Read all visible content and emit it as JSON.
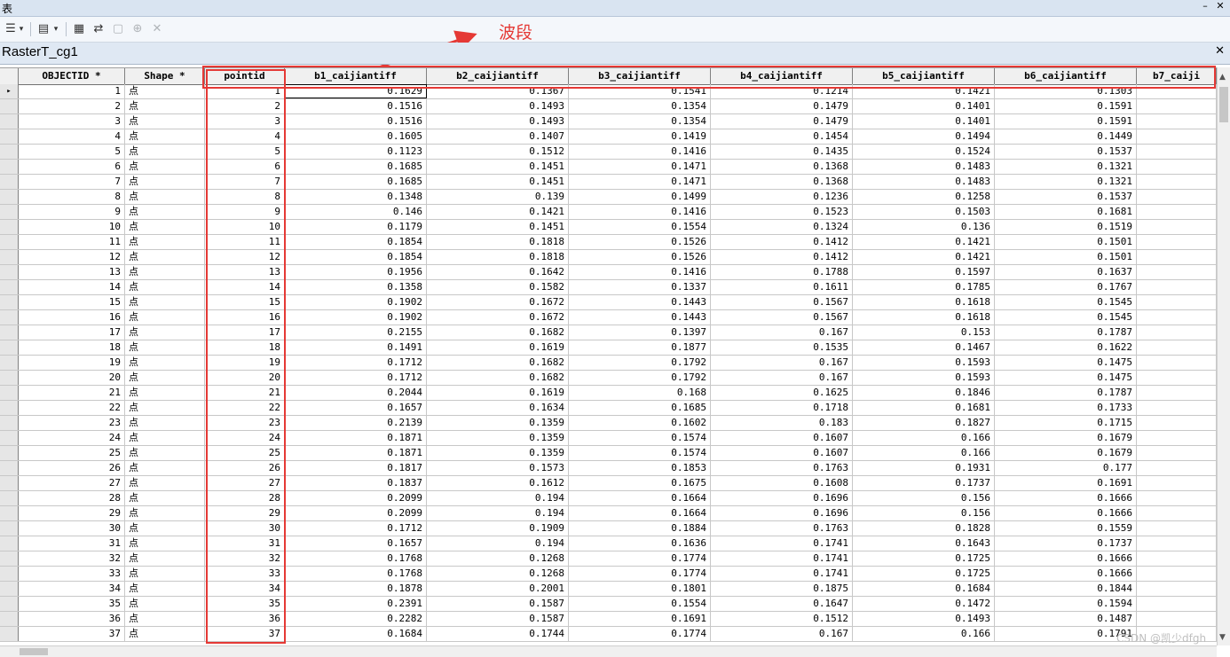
{
  "window": {
    "title": "表"
  },
  "annotation": {
    "label": "波段"
  },
  "table": {
    "tab_name": "RasterT_cg1",
    "columns": [
      "OBJECTID *",
      "Shape *",
      "pointid",
      "b1_caijiantiff",
      "b2_caijiantiff",
      "b3_caijiantiff",
      "b4_caijiantiff",
      "b5_caijiantiff",
      "b6_caijiantiff",
      "b7_caiji"
    ],
    "rows": [
      [
        "1",
        "点",
        "1",
        "0.1629",
        "0.1367",
        "0.1541",
        "0.1214",
        "0.1421",
        "0.1303"
      ],
      [
        "2",
        "点",
        "2",
        "0.1516",
        "0.1493",
        "0.1354",
        "0.1479",
        "0.1401",
        "0.1591"
      ],
      [
        "3",
        "点",
        "3",
        "0.1516",
        "0.1493",
        "0.1354",
        "0.1479",
        "0.1401",
        "0.1591"
      ],
      [
        "4",
        "点",
        "4",
        "0.1605",
        "0.1407",
        "0.1419",
        "0.1454",
        "0.1494",
        "0.1449"
      ],
      [
        "5",
        "点",
        "5",
        "0.1123",
        "0.1512",
        "0.1416",
        "0.1435",
        "0.1524",
        "0.1537"
      ],
      [
        "6",
        "点",
        "6",
        "0.1685",
        "0.1451",
        "0.1471",
        "0.1368",
        "0.1483",
        "0.1321"
      ],
      [
        "7",
        "点",
        "7",
        "0.1685",
        "0.1451",
        "0.1471",
        "0.1368",
        "0.1483",
        "0.1321"
      ],
      [
        "8",
        "点",
        "8",
        "0.1348",
        "0.139",
        "0.1499",
        "0.1236",
        "0.1258",
        "0.1537"
      ],
      [
        "9",
        "点",
        "9",
        "0.146",
        "0.1421",
        "0.1416",
        "0.1523",
        "0.1503",
        "0.1681"
      ],
      [
        "10",
        "点",
        "10",
        "0.1179",
        "0.1451",
        "0.1554",
        "0.1324",
        "0.136",
        "0.1519"
      ],
      [
        "11",
        "点",
        "11",
        "0.1854",
        "0.1818",
        "0.1526",
        "0.1412",
        "0.1421",
        "0.1501"
      ],
      [
        "12",
        "点",
        "12",
        "0.1854",
        "0.1818",
        "0.1526",
        "0.1412",
        "0.1421",
        "0.1501"
      ],
      [
        "13",
        "点",
        "13",
        "0.1956",
        "0.1642",
        "0.1416",
        "0.1788",
        "0.1597",
        "0.1637"
      ],
      [
        "14",
        "点",
        "14",
        "0.1358",
        "0.1582",
        "0.1337",
        "0.1611",
        "0.1785",
        "0.1767"
      ],
      [
        "15",
        "点",
        "15",
        "0.1902",
        "0.1672",
        "0.1443",
        "0.1567",
        "0.1618",
        "0.1545"
      ],
      [
        "16",
        "点",
        "16",
        "0.1902",
        "0.1672",
        "0.1443",
        "0.1567",
        "0.1618",
        "0.1545"
      ],
      [
        "17",
        "点",
        "17",
        "0.2155",
        "0.1682",
        "0.1397",
        "0.167",
        "0.153",
        "0.1787"
      ],
      [
        "18",
        "点",
        "18",
        "0.1491",
        "0.1619",
        "0.1877",
        "0.1535",
        "0.1467",
        "0.1622"
      ],
      [
        "19",
        "点",
        "19",
        "0.1712",
        "0.1682",
        "0.1792",
        "0.167",
        "0.1593",
        "0.1475"
      ],
      [
        "20",
        "点",
        "20",
        "0.1712",
        "0.1682",
        "0.1792",
        "0.167",
        "0.1593",
        "0.1475"
      ],
      [
        "21",
        "点",
        "21",
        "0.2044",
        "0.1619",
        "0.168",
        "0.1625",
        "0.1846",
        "0.1787"
      ],
      [
        "22",
        "点",
        "22",
        "0.1657",
        "0.1634",
        "0.1685",
        "0.1718",
        "0.1681",
        "0.1733"
      ],
      [
        "23",
        "点",
        "23",
        "0.2139",
        "0.1359",
        "0.1602",
        "0.183",
        "0.1827",
        "0.1715"
      ],
      [
        "24",
        "点",
        "24",
        "0.1871",
        "0.1359",
        "0.1574",
        "0.1607",
        "0.166",
        "0.1679"
      ],
      [
        "25",
        "点",
        "25",
        "0.1871",
        "0.1359",
        "0.1574",
        "0.1607",
        "0.166",
        "0.1679"
      ],
      [
        "26",
        "点",
        "26",
        "0.1817",
        "0.1573",
        "0.1853",
        "0.1763",
        "0.1931",
        "0.177"
      ],
      [
        "27",
        "点",
        "27",
        "0.1837",
        "0.1612",
        "0.1675",
        "0.1608",
        "0.1737",
        "0.1691"
      ],
      [
        "28",
        "点",
        "28",
        "0.2099",
        "0.194",
        "0.1664",
        "0.1696",
        "0.156",
        "0.1666"
      ],
      [
        "29",
        "点",
        "29",
        "0.2099",
        "0.194",
        "0.1664",
        "0.1696",
        "0.156",
        "0.1666"
      ],
      [
        "30",
        "点",
        "30",
        "0.1712",
        "0.1909",
        "0.1884",
        "0.1763",
        "0.1828",
        "0.1559"
      ],
      [
        "31",
        "点",
        "31",
        "0.1657",
        "0.194",
        "0.1636",
        "0.1741",
        "0.1643",
        "0.1737"
      ],
      [
        "32",
        "点",
        "32",
        "0.1768",
        "0.1268",
        "0.1774",
        "0.1741",
        "0.1725",
        "0.1666"
      ],
      [
        "33",
        "点",
        "33",
        "0.1768",
        "0.1268",
        "0.1774",
        "0.1741",
        "0.1725",
        "0.1666"
      ],
      [
        "34",
        "点",
        "34",
        "0.1878",
        "0.2001",
        "0.1801",
        "0.1875",
        "0.1684",
        "0.1844"
      ],
      [
        "35",
        "点",
        "35",
        "0.2391",
        "0.1587",
        "0.1554",
        "0.1647",
        "0.1472",
        "0.1594"
      ],
      [
        "36",
        "点",
        "36",
        "0.2282",
        "0.1587",
        "0.1691",
        "0.1512",
        "0.1493",
        "0.1487"
      ],
      [
        "37",
        "点",
        "37",
        "0.1684",
        "0.1744",
        "0.1774",
        "0.167",
        "0.166",
        "0.1791"
      ]
    ]
  },
  "watermark": "CSDN @凯少dfgh",
  "colors": {
    "annotation": "#e53935",
    "header_bg": "#f0f0f0",
    "grid_line": "#c8c8c8"
  },
  "icons": [
    "table-options-icon",
    "related-tables-icon",
    "select-by-attributes-icon",
    "switch-selection-icon",
    "clear-selection-icon",
    "zoom-to-selected-icon",
    "delete-selected-icon"
  ]
}
